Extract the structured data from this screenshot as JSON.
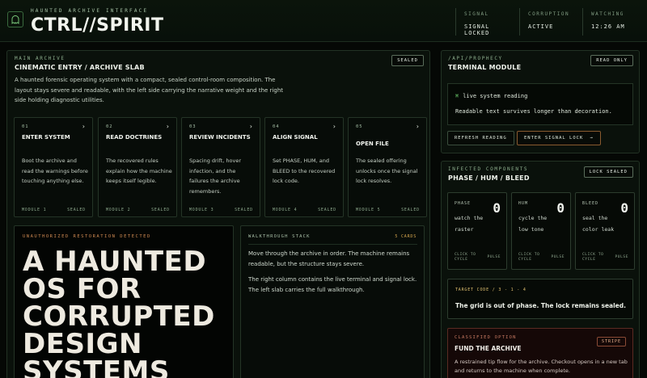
{
  "header": {
    "kicker": "HAUNTED ARCHIVE INTERFACE",
    "title": "CTRL//SPIRIT",
    "status": [
      {
        "label": "SIGNAL",
        "value": "SIGNAL LOCKED"
      },
      {
        "label": "CORRUPTION",
        "value": "ACTIVE"
      },
      {
        "label": "WATCHING",
        "value": "12:26 AM"
      }
    ]
  },
  "main": {
    "kicker": "MAIN ARCHIVE",
    "title": "CINEMATIC ENTRY / ARCHIVE SLAB",
    "badge": "SEALED",
    "intro": "A haunted forensic operating system with a compact, sealed control-room composition. The layout stays severe and readable, with the left side carrying the narrative weight and the right side holding diagnostic utilities.",
    "modules": [
      {
        "num": "01",
        "title": "ENTER SYSTEM",
        "desc": "Boot the archive and read the warnings before touching anything else.",
        "foot_left": "MODULE 1",
        "foot_right": "SEALED"
      },
      {
        "num": "02",
        "title": "READ DOCTRINES",
        "desc": "The recovered rules explain how the machine keeps itself legible.",
        "foot_left": "MODULE 2",
        "foot_right": "SEALED"
      },
      {
        "num": "03",
        "title": "REVIEW INCIDENTS",
        "desc": "Spacing drift, hover infection, and the failures the archive remembers.",
        "foot_left": "MODULE 3",
        "foot_right": "SEALED"
      },
      {
        "num": "04",
        "title": "ALIGN SIGNAL",
        "desc": "Set PHASE, HUM, and BLEED to the recovered lock code.",
        "foot_left": "MODULE 4",
        "foot_right": "SEALED"
      },
      {
        "num": "05",
        "title": "OPEN FILE",
        "desc": "The sealed offering unlocks once the signal lock resolves.",
        "foot_left": "MODULE 5",
        "foot_right": "SEALED"
      }
    ],
    "hero": {
      "kicker": "UNAUTHORIZED RESTORATION DETECTED",
      "headline": "A HAUNTED OS FOR CORRUPTED DESIGN SYSTEMS"
    },
    "walkthrough": {
      "kicker": "WALKTHROUGH STACK",
      "count": "5 CARDS",
      "p1": "Move through the archive in order. The machine remains readable, but the structure stays severe.",
      "p2": "The right column contains the live terminal and signal lock. The left slab carries the full walkthrough."
    }
  },
  "terminal": {
    "kicker": "/API/PROPHECY",
    "title": "TERMINAL MODULE",
    "badge": "READ ONLY",
    "line1": "live system reading",
    "line2": "Readable text survives longer than decoration.",
    "refresh": "REFRESH READING",
    "enter": "ENTER SIGNAL LOCK",
    "enter_arrow": "→"
  },
  "infected": {
    "kicker": "INFECTED COMPONENTS",
    "title": "PHASE / HUM / BLEED",
    "badge": "LOCK SEALED",
    "cards": [
      {
        "label": "PHASE",
        "value": "0",
        "desc": "watch the raster",
        "foot1": "CLICK TO",
        "foot1b": "CYCLE",
        "foot2": "PULSE"
      },
      {
        "label": "HUM",
        "value": "0",
        "desc": "cycle the low tone",
        "foot1": "CLICK TO",
        "foot1b": "CYCLE",
        "foot2": "PULSE"
      },
      {
        "label": "BLEED",
        "value": "0",
        "desc": "seal the color leak",
        "foot1": "CLICK TO",
        "foot1b": "CYCLE",
        "foot2": "PULSE"
      }
    ],
    "target_code": "TARGET CODE / 3 - 1 - 4",
    "target_text": "The grid is out of phase. The lock remains sealed.",
    "offer": {
      "kicker": "CLASSIFIED OPTION",
      "title": "FUND THE ARCHIVE",
      "badge": "STRIPE",
      "desc": "A restrained tip flow for the archive. Checkout opens in a new tab and returns to the machine when complete."
    }
  },
  "colors": {
    "background": "#050805",
    "accent_green": "#6fd36f",
    "warning_orange": "#d08a52",
    "danger_red": "#5a2a22"
  }
}
